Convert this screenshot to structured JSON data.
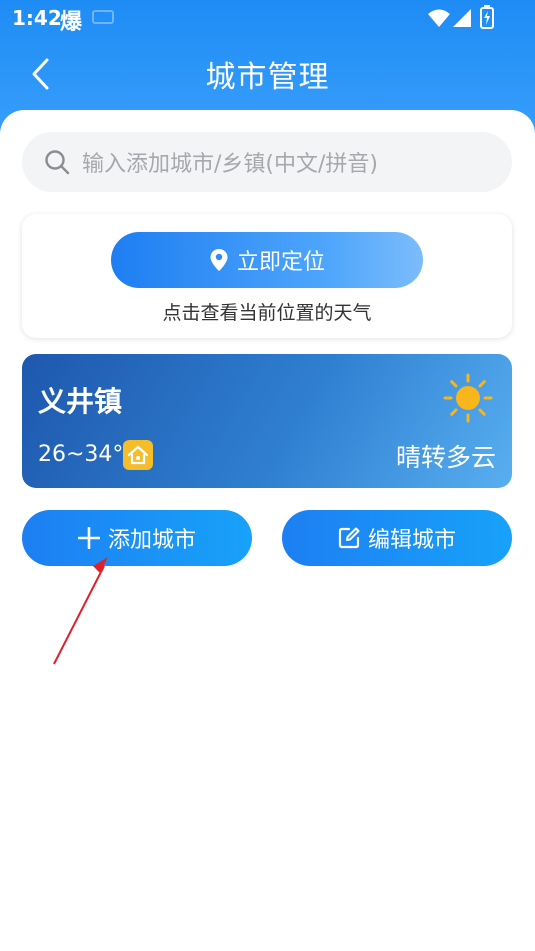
{
  "status_bar": {
    "time": "1:42",
    "app_icon": "爆"
  },
  "header": {
    "title": "城市管理",
    "back_icon": "chevron-left-icon"
  },
  "search": {
    "placeholder": "输入添加城市/乡镇(中文/拼音)"
  },
  "locate_card": {
    "button_label": "立即定位",
    "hint": "点击查看当前位置的天气"
  },
  "cities": [
    {
      "name": "义井镇",
      "temp": "26~34°",
      "weather": "晴转多云",
      "icon": "sun-icon"
    }
  ],
  "actions": {
    "add_label": "添加城市",
    "edit_label": "编辑城市"
  },
  "colors": {
    "header_blue": "#1e8cf5",
    "button_blue": "#1d7ff2",
    "card_dark_blue": "#1e58ad",
    "sun_yellow": "#f8b51c",
    "annotation_red": "#e0202a"
  }
}
